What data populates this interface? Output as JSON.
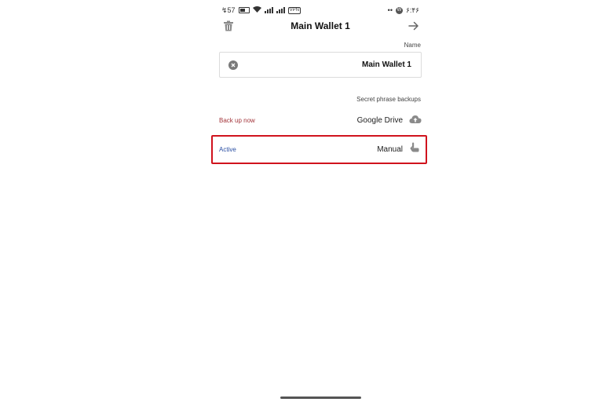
{
  "status_bar": {
    "left_text": "↯57",
    "vpn_label": "VPN",
    "right_dots": "••",
    "badge": "W",
    "time": "۶:۴۶"
  },
  "header": {
    "title": "Main Wallet 1",
    "trash_icon": "trash-icon",
    "forward_icon": "arrow-right-icon"
  },
  "name_section": {
    "label": "Name",
    "value": "Main Wallet 1",
    "clear_icon": "clear-icon"
  },
  "backups": {
    "label": "Secret phrase backups",
    "items": [
      {
        "title": "Google Drive",
        "status": "Back up now",
        "status_color": "#a3343a",
        "icon": "cloud-upload-icon"
      },
      {
        "title": "Manual",
        "status": "Active",
        "status_color": "#2a4fa3",
        "icon": "hand-pointer-icon"
      }
    ]
  },
  "highlight_color": "#d0131d"
}
